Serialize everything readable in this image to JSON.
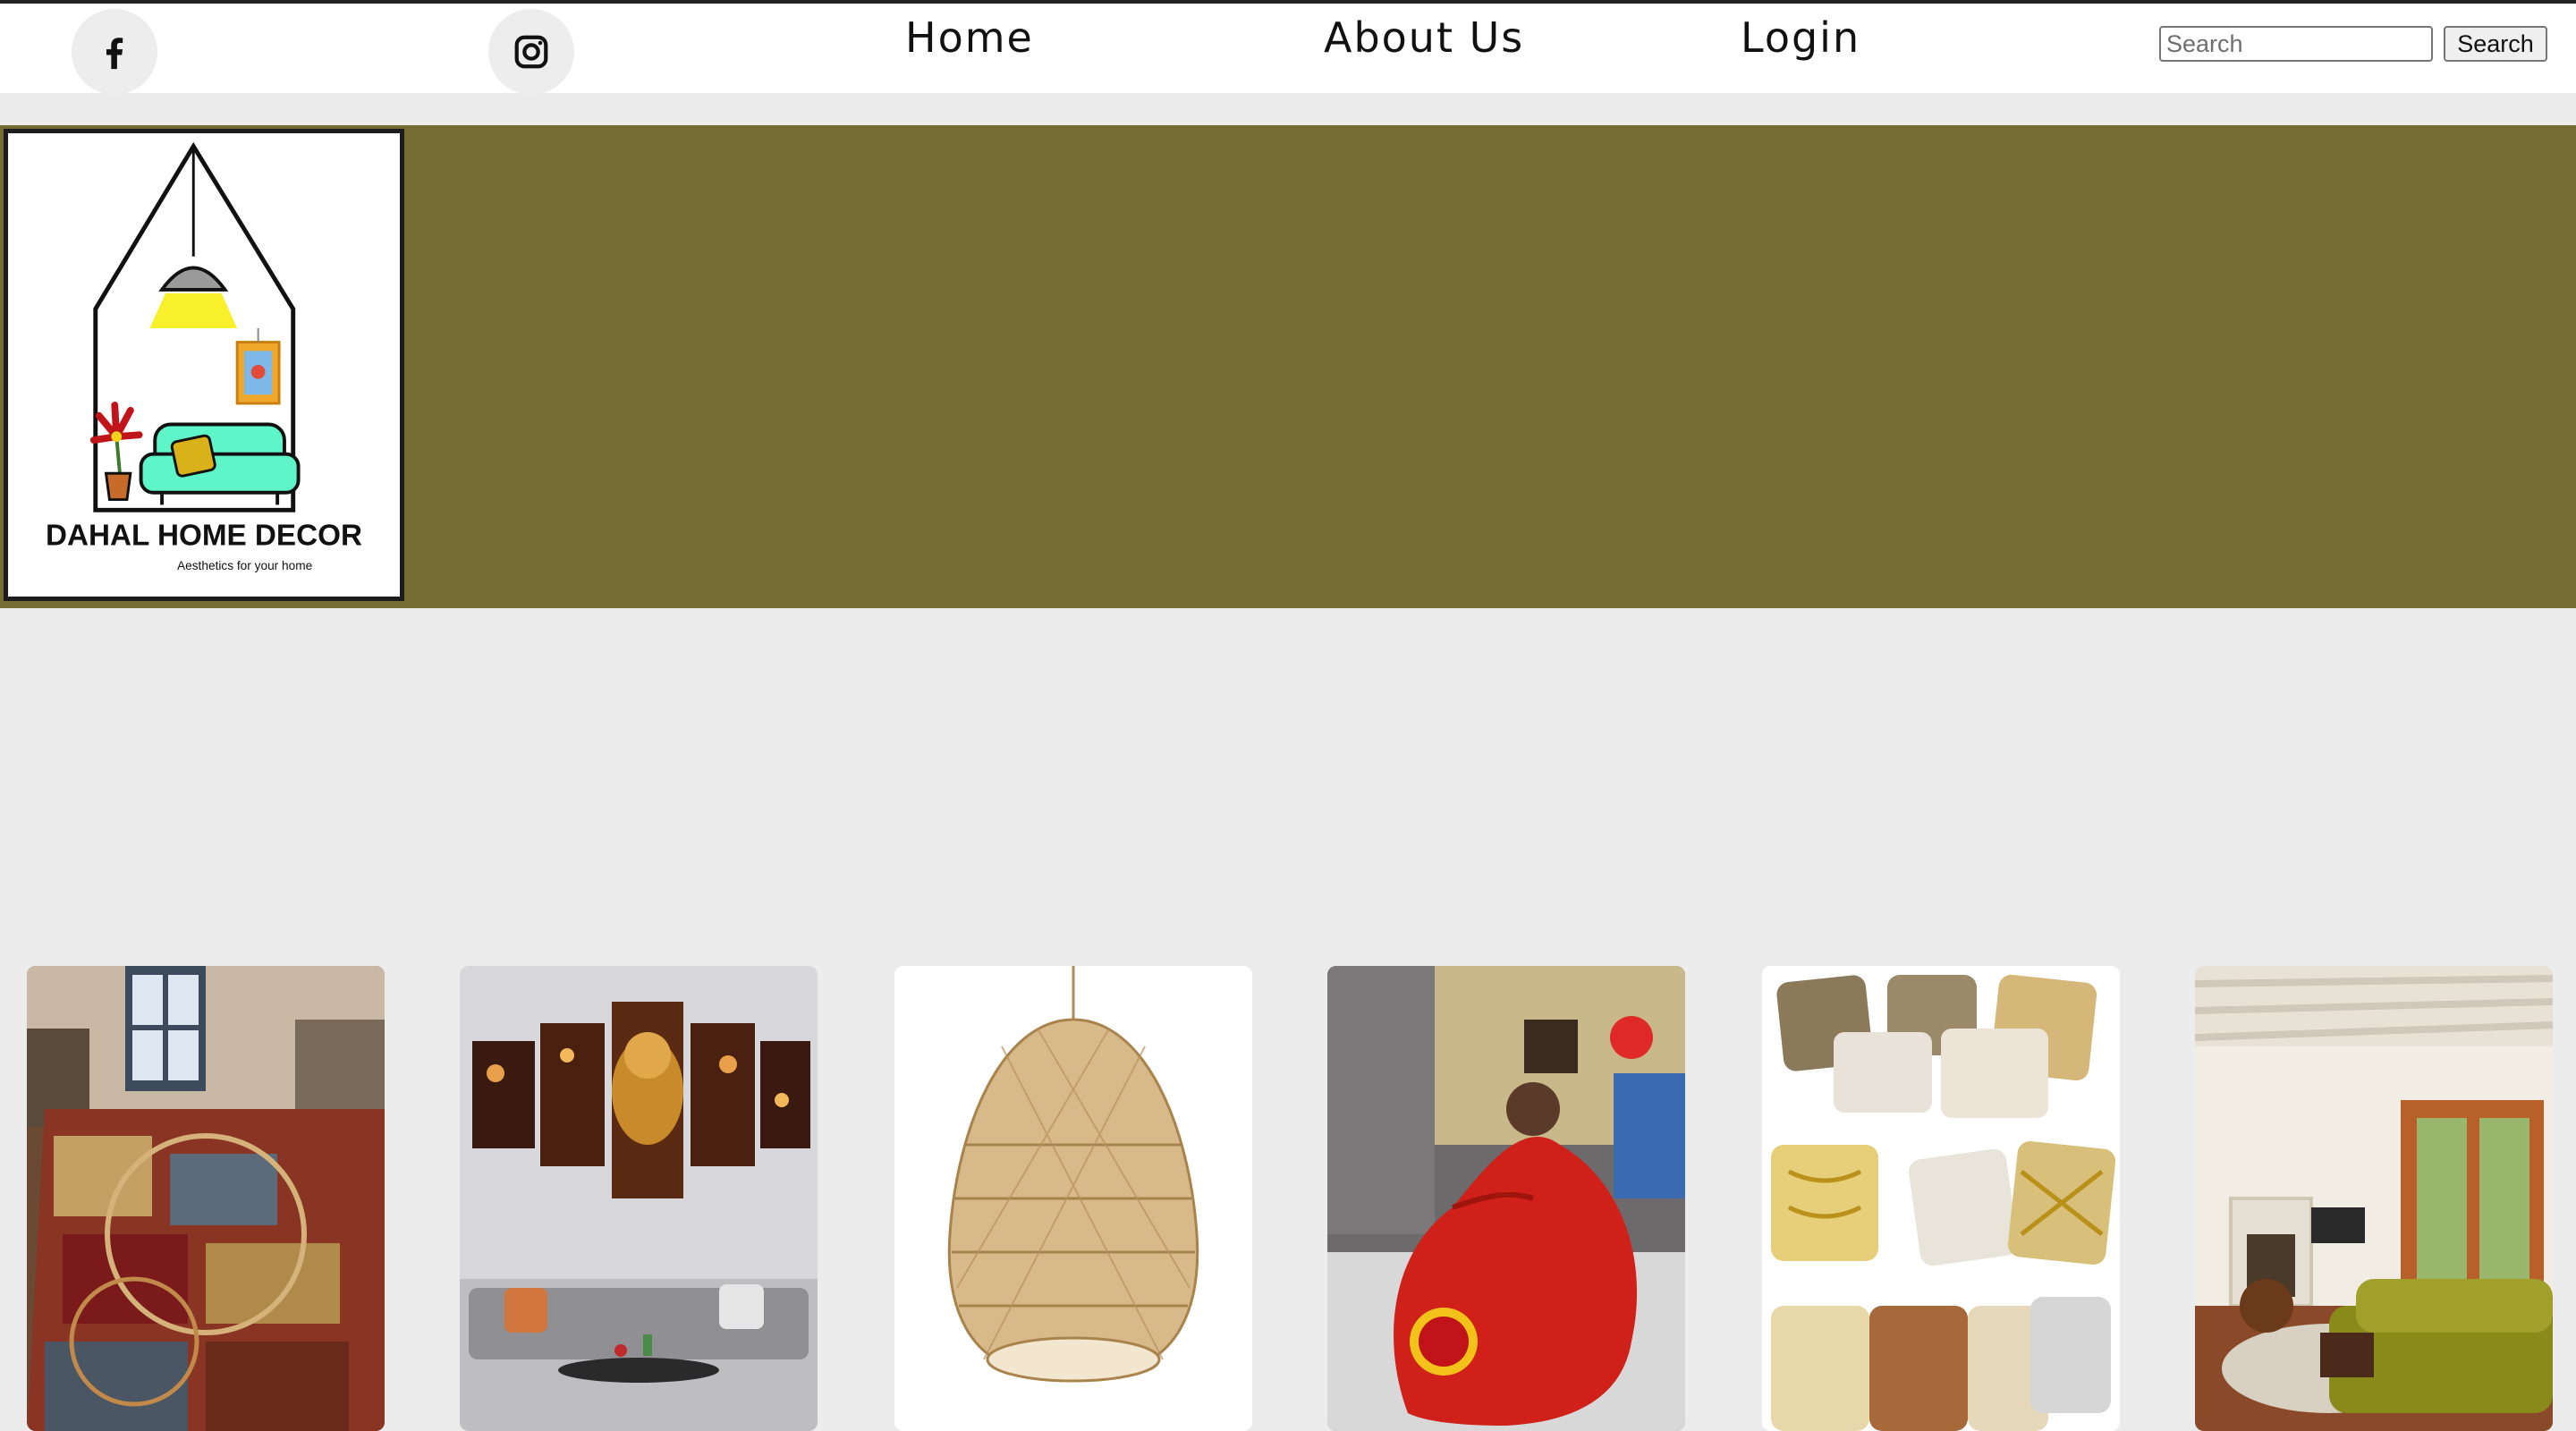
{
  "header": {
    "social": [
      {
        "icon": "facebook-icon"
      },
      {
        "icon": "instagram-icon"
      }
    ],
    "nav": [
      {
        "label": "Home"
      },
      {
        "label": "About Us"
      },
      {
        "label": "Login"
      }
    ],
    "search": {
      "placeholder": "Search",
      "value": "",
      "button_label": "Search"
    }
  },
  "banner": {
    "color": "#766d34",
    "logo": {
      "brand": "DAHAL HOME DECOR",
      "tagline": "Aesthetics for your home"
    }
  },
  "gallery": {
    "items": [
      {
        "image": "patterned-area-rug-in-living-room"
      },
      {
        "image": "ganesha-canvas-wall-art-above-sofa"
      },
      {
        "image": "rattan-pendant-lamp-shade"
      },
      {
        "image": "red-manchester-united-bean-bag"
      },
      {
        "image": "decorative-gold-pattern-cushions"
      },
      {
        "image": "bright-living-room-interior"
      }
    ]
  },
  "colors": {
    "page_background": "#ececec",
    "banner": "#766d34",
    "sofa_accent": "#5ef5c8"
  }
}
